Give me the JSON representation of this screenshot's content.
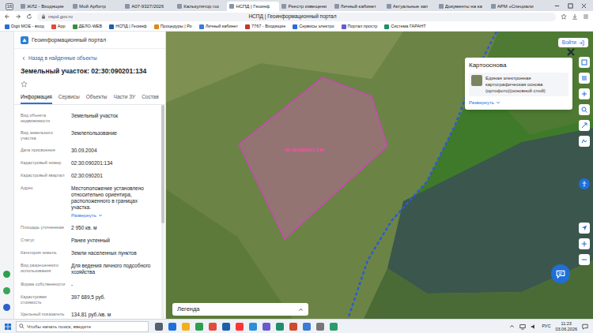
{
  "browser": {
    "tab_count": "16",
    "tabs": [
      {
        "label": "ЖЛ2 - Входящие",
        "selected": false
      },
      {
        "label": "Мой Арбитр",
        "selected": false
      },
      {
        "label": "А07-9327/2026",
        "selected": false
      },
      {
        "label": "Калькулятор гос",
        "selected": false
      },
      {
        "label": "НСПД | Геоинф",
        "selected": true
      },
      {
        "label": "Реестр извещени",
        "selected": false
      },
      {
        "label": "Личный кабинет",
        "selected": false
      },
      {
        "label": "Актуальные зап",
        "selected": false
      },
      {
        "label": "Документы на ка",
        "selected": false
      },
      {
        "label": "АРМ «Специали",
        "selected": false
      }
    ],
    "address": "nspd.gov.ru",
    "page_title": "НСПД | Геоинформационный портал",
    "bookmarks": [
      "Digit МОЕ - вход",
      "App",
      "ДЕЛО-WEB",
      "НСПД | Геоинф",
      "Процедуры | Ро",
      "Личный кабинет",
      "7767 - Входящие",
      "Сервисы электро",
      "Портал простр",
      "Система ГАРАНТ"
    ]
  },
  "panel": {
    "portal_name": "Геоинформационный портал",
    "back": "Назад в найденные объекты",
    "object_title": "Земельный участок: 02:30:090201:134",
    "favorite": false,
    "tabs": [
      {
        "label": "Информация",
        "selected": true
      },
      {
        "label": "Сервисы",
        "selected": false
      },
      {
        "label": "Объекты",
        "selected": false
      },
      {
        "label": "Части ЗУ",
        "selected": false
      },
      {
        "label": "Состав",
        "selected": false
      }
    ],
    "rows": [
      {
        "label": "Вид объекта недвижимости",
        "value": "Земельный участок"
      },
      {
        "label": "Вид земельного участка",
        "value": "Землепользование"
      },
      {
        "label": "Дата присвоения",
        "value": "30.09.2004"
      },
      {
        "label": "Кадастровый номер",
        "value": "02:30:090201:134"
      },
      {
        "label": "Кадастровый квартал",
        "value": "02:30:090201"
      },
      {
        "label": "Адрес",
        "value": "Местоположение установлено относительно ориентира, расположенного в границах участка.",
        "link": "Развернуть"
      },
      {
        "label": "Площадь уточненная",
        "value": "2 950 кв. м"
      },
      {
        "label": "Статус",
        "value": "Ранее учтенный"
      },
      {
        "label": "Категория земель",
        "value": "Земли населенных пунктов"
      },
      {
        "label": "Вид разрешенного использования",
        "value": "Для ведения личного подсобного хозяйства"
      },
      {
        "label": "Форма собственности",
        "value": "-"
      },
      {
        "label": "Кадастровая стоимость",
        "value": "397 689,5 руб."
      },
      {
        "label": "Удельный показатель",
        "value": "134,81 руб./кв. м"
      }
    ]
  },
  "map": {
    "parcel_label": "02:30:090201:134",
    "login": "Войти",
    "basemap": {
      "title": "Картооснова",
      "layer": "Единая электронная картографическая основа (ортофото)(основной слой)",
      "expand": "Развернуть"
    },
    "legend": "Легенда"
  },
  "taskbar": {
    "search_placeholder": "Чтобы начать поиск, введите",
    "lang": "РУС",
    "time": "11:23",
    "date": "03.06.2026"
  }
}
